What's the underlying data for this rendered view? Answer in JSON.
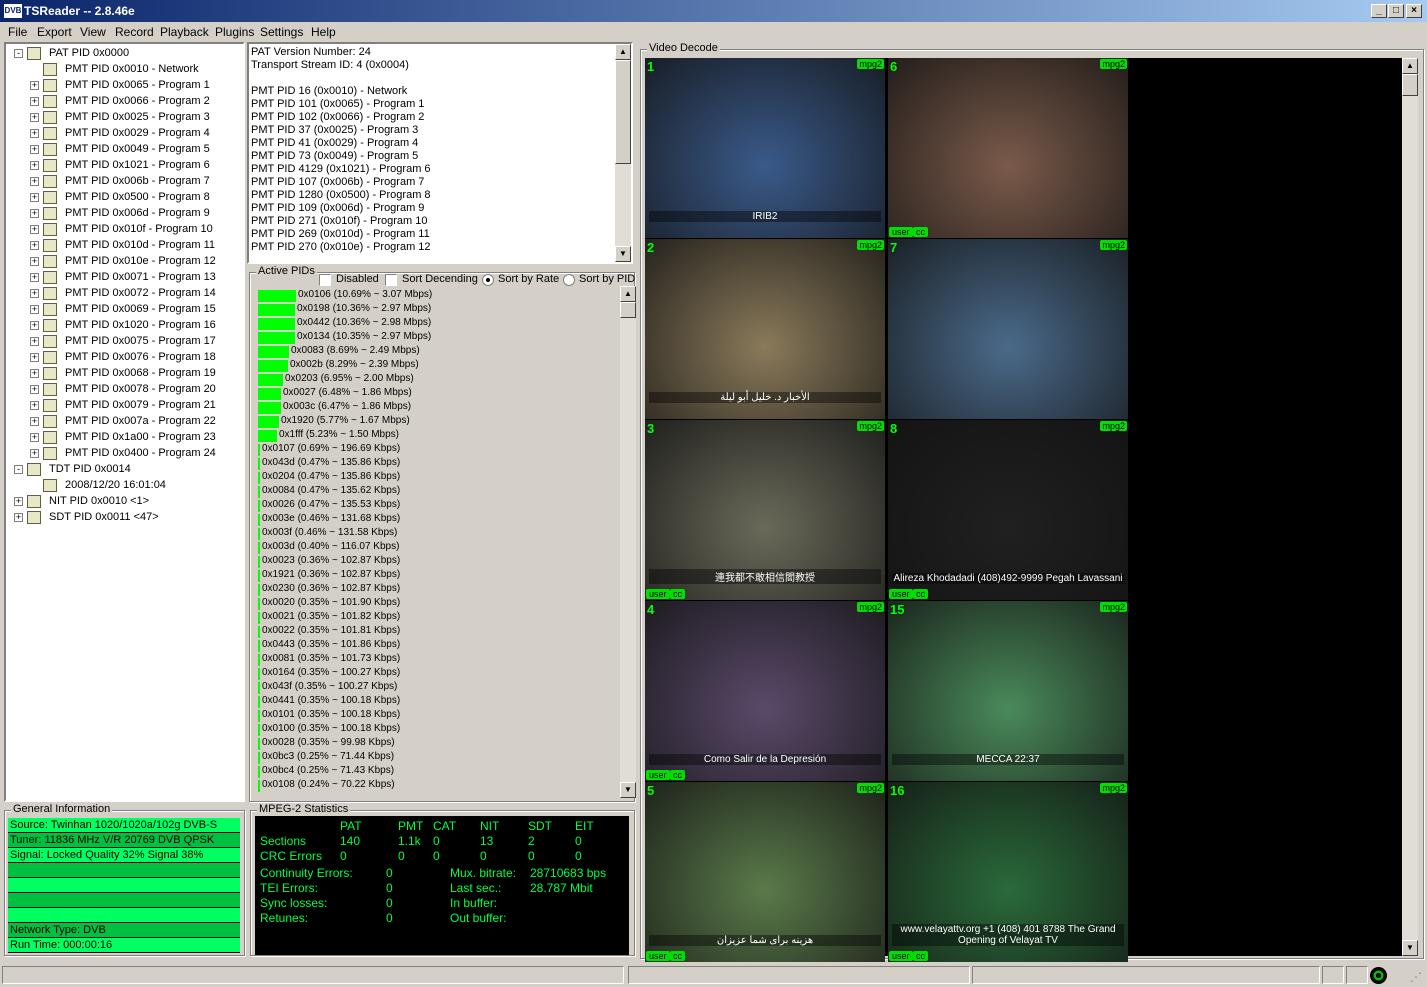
{
  "window": {
    "title": "TSReader -- 2.8.46e",
    "icon": "DVB"
  },
  "menu": [
    "File",
    "Export",
    "View",
    "Record",
    "Playback",
    "Plugins",
    "Settings",
    "Help"
  ],
  "tree": [
    {
      "label": "PAT PID 0x0000",
      "level": 0,
      "exp": "-"
    },
    {
      "label": "PMT PID 0x0010 - Network",
      "level": 1,
      "exp": ""
    },
    {
      "label": "PMT PID 0x0065 - Program 1",
      "level": 1,
      "exp": "+"
    },
    {
      "label": "PMT PID 0x0066 - Program 2",
      "level": 1,
      "exp": "+"
    },
    {
      "label": "PMT PID 0x0025 - Program 3",
      "level": 1,
      "exp": "+"
    },
    {
      "label": "PMT PID 0x0029 - Program 4",
      "level": 1,
      "exp": "+"
    },
    {
      "label": "PMT PID 0x0049 - Program 5",
      "level": 1,
      "exp": "+"
    },
    {
      "label": "PMT PID 0x1021 - Program 6",
      "level": 1,
      "exp": "+"
    },
    {
      "label": "PMT PID 0x006b - Program 7",
      "level": 1,
      "exp": "+"
    },
    {
      "label": "PMT PID 0x0500 - Program 8",
      "level": 1,
      "exp": "+"
    },
    {
      "label": "PMT PID 0x006d - Program 9",
      "level": 1,
      "exp": "+"
    },
    {
      "label": "PMT PID 0x010f - Program 10",
      "level": 1,
      "exp": "+"
    },
    {
      "label": "PMT PID 0x010d - Program 11",
      "level": 1,
      "exp": "+"
    },
    {
      "label": "PMT PID 0x010e - Program 12",
      "level": 1,
      "exp": "+"
    },
    {
      "label": "PMT PID 0x0071 - Program 13",
      "level": 1,
      "exp": "+"
    },
    {
      "label": "PMT PID 0x0072 - Program 14",
      "level": 1,
      "exp": "+"
    },
    {
      "label": "PMT PID 0x0069 - Program 15",
      "level": 1,
      "exp": "+"
    },
    {
      "label": "PMT PID 0x1020 - Program 16",
      "level": 1,
      "exp": "+"
    },
    {
      "label": "PMT PID 0x0075 - Program 17",
      "level": 1,
      "exp": "+"
    },
    {
      "label": "PMT PID 0x0076 - Program 18",
      "level": 1,
      "exp": "+"
    },
    {
      "label": "PMT PID 0x0068 - Program 19",
      "level": 1,
      "exp": "+"
    },
    {
      "label": "PMT PID 0x0078 - Program 20",
      "level": 1,
      "exp": "+"
    },
    {
      "label": "PMT PID 0x0079 - Program 21",
      "level": 1,
      "exp": "+"
    },
    {
      "label": "PMT PID 0x007a - Program 22",
      "level": 1,
      "exp": "+"
    },
    {
      "label": "PMT PID 0x1a00 - Program 23",
      "level": 1,
      "exp": "+"
    },
    {
      "label": "PMT PID 0x0400 - Program 24",
      "level": 1,
      "exp": "+"
    },
    {
      "label": "TDT PID 0x0014",
      "level": 0,
      "exp": "-"
    },
    {
      "label": "2008/12/20 16:01:04",
      "level": 1,
      "exp": ""
    },
    {
      "label": "NIT PID 0x0010 <1>",
      "level": 0,
      "exp": "+"
    },
    {
      "label": "SDT PID 0x0011 <47>",
      "level": 0,
      "exp": "+"
    }
  ],
  "patinfo": [
    "PAT Version Number: 24",
    "Transport Stream ID: 4 (0x0004)",
    "",
    "PMT PID 16 (0x0010) - Network",
    "PMT PID 101 (0x0065) - Program 1",
    "PMT PID 102 (0x0066) - Program 2",
    "PMT PID 37 (0x0025) - Program 3",
    "PMT PID 41 (0x0029) - Program 4",
    "PMT PID 73 (0x0049) - Program 5",
    "PMT PID 4129 (0x1021) - Program 6",
    "PMT PID 107 (0x006b) - Program 7",
    "PMT PID 1280 (0x0500) - Program 8",
    "PMT PID 109 (0x006d) - Program 9",
    "PMT PID 271 (0x010f) - Program 10",
    "PMT PID 269 (0x010d) - Program 11",
    "PMT PID 270 (0x010e) - Program 12"
  ],
  "active_pids": {
    "caption": "Active PIDs",
    "disabled_label": "Disabled",
    "sort_desc_label": "Sort Decending",
    "sort_rate_label": "Sort by Rate",
    "sort_pid_label": "Sort by PID",
    "rows": [
      {
        "text": "0x0106 (10.69% ~ 3.07 Mbps)",
        "pct": 10.69
      },
      {
        "text": "0x0198 (10.36% ~ 2.97 Mbps)",
        "pct": 10.36
      },
      {
        "text": "0x0442 (10.36% ~ 2.98 Mbps)",
        "pct": 10.36
      },
      {
        "text": "0x0134 (10.35% ~ 2.97 Mbps)",
        "pct": 10.35
      },
      {
        "text": "0x0083 (8.69% ~ 2.49 Mbps)",
        "pct": 8.69
      },
      {
        "text": "0x002b (8.29% ~ 2.39 Mbps)",
        "pct": 8.29
      },
      {
        "text": "0x0203 (6.95% ~ 2.00 Mbps)",
        "pct": 6.95
      },
      {
        "text": "0x0027 (6.48% ~ 1.86 Mbps)",
        "pct": 6.48
      },
      {
        "text": "0x003c (6.47% ~ 1.86 Mbps)",
        "pct": 6.47
      },
      {
        "text": "0x1920 (5.77% ~ 1.67 Mbps)",
        "pct": 5.77
      },
      {
        "text": "0x1fff (5.23% ~ 1.50 Mbps)",
        "pct": 5.23
      },
      {
        "text": "0x0107 (0.69% ~ 196.69 Kbps)",
        "pct": 0.69
      },
      {
        "text": "0x043d (0.47% ~ 135.86 Kbps)",
        "pct": 0.47
      },
      {
        "text": "0x0204 (0.47% ~ 135.86 Kbps)",
        "pct": 0.47
      },
      {
        "text": "0x0084 (0.47% ~ 135.62 Kbps)",
        "pct": 0.47
      },
      {
        "text": "0x0026 (0.47% ~ 135.53 Kbps)",
        "pct": 0.47
      },
      {
        "text": "0x003e (0.46% ~ 131.68 Kbps)",
        "pct": 0.46
      },
      {
        "text": "0x003f (0.46% ~ 131.58 Kbps)",
        "pct": 0.46
      },
      {
        "text": "0x003d (0.40% ~ 116.07 Kbps)",
        "pct": 0.4
      },
      {
        "text": "0x0023 (0.36% ~ 102.87 Kbps)",
        "pct": 0.36
      },
      {
        "text": "0x1921 (0.36% ~ 102.87 Kbps)",
        "pct": 0.36
      },
      {
        "text": "0x0230 (0.36% ~ 102.87 Kbps)",
        "pct": 0.36
      },
      {
        "text": "0x0020 (0.35% ~ 101.90 Kbps)",
        "pct": 0.35
      },
      {
        "text": "0x0021 (0.35% ~ 101.82 Kbps)",
        "pct": 0.35
      },
      {
        "text": "0x0022 (0.35% ~ 101.81 Kbps)",
        "pct": 0.35
      },
      {
        "text": "0x0443 (0.35% ~ 101.86 Kbps)",
        "pct": 0.35
      },
      {
        "text": "0x0081 (0.35% ~ 101.73 Kbps)",
        "pct": 0.35
      },
      {
        "text": "0x0164 (0.35% ~ 100.27 Kbps)",
        "pct": 0.35
      },
      {
        "text": "0x043f (0.35% ~ 100.27 Kbps)",
        "pct": 0.35
      },
      {
        "text": "0x0441 (0.35% ~ 100.18 Kbps)",
        "pct": 0.35
      },
      {
        "text": "0x0101 (0.35% ~ 100.18 Kbps)",
        "pct": 0.35
      },
      {
        "text": "0x0100 (0.35% ~ 100.18 Kbps)",
        "pct": 0.35
      },
      {
        "text": "0x0028 (0.35% ~ 99.98 Kbps)",
        "pct": 0.35
      },
      {
        "text": "0x0bc3 (0.25% ~ 71.44 Kbps)",
        "pct": 0.25
      },
      {
        "text": "0x0bc4 (0.25% ~ 71.43 Kbps)",
        "pct": 0.25
      },
      {
        "text": "0x0108 (0.24% ~ 70.22 Kbps)",
        "pct": 0.24
      }
    ]
  },
  "general": {
    "caption": "General Information",
    "lines": [
      "Source: Twinhan 1020/1020a/102g DVB-S",
      "Tuner: 11836 MHz V/R 20769 DVB QPSK",
      "Signal: Locked Quality 32% Signal 38%",
      "",
      "",
      "",
      "",
      "Network Type: DVB",
      "Run Time: 000:00:16"
    ]
  },
  "mpeg": {
    "caption": "MPEG-2 Statistics",
    "headers": [
      "PAT",
      "PMT",
      "CAT",
      "NIT",
      "SDT",
      "EIT"
    ],
    "sections_label": "Sections",
    "sections": [
      "140",
      "1.1k",
      "0",
      "13",
      "2",
      "0"
    ],
    "crc_label": "CRC Errors",
    "crc": [
      "0",
      "0",
      "0",
      "0",
      "0",
      "0"
    ],
    "left": [
      {
        "l": "Continuity Errors:",
        "v": "0"
      },
      {
        "l": "TEI Errors:",
        "v": "0"
      },
      {
        "l": "Sync losses:",
        "v": "0"
      },
      {
        "l": "Retunes:",
        "v": "0"
      }
    ],
    "right": [
      {
        "l": "Mux. bitrate:",
        "v": "28710683 bps"
      },
      {
        "l": "Last sec.:",
        "v": "28.787 Mbit"
      },
      {
        "l": "In buffer:",
        "v": ""
      },
      {
        "l": "Out buffer:",
        "v": ""
      }
    ]
  },
  "video": {
    "caption": "Video Decode",
    "tiles": [
      {
        "num": "1",
        "codec": "mpg2",
        "badges": [],
        "desc": "studio set",
        "color": "#3a5a8a",
        "tag": "IRIB2"
      },
      {
        "num": "6",
        "codec": "mpg2",
        "badges": [
          "user",
          "cc"
        ],
        "desc": "talk show",
        "color": "#7a5a4a",
        "tag": ""
      },
      {
        "num": "2",
        "codec": "mpg2",
        "badges": [],
        "desc": "news",
        "color": "#8a7a5a",
        "tag": "الأخبار د. خليل أبو ليلة"
      },
      {
        "num": "7",
        "codec": "mpg2",
        "badges": [],
        "desc": "map",
        "color": "#4a6a8a",
        "tag": ""
      },
      {
        "num": "3",
        "codec": "mpg2",
        "badges": [
          "user",
          "cc"
        ],
        "desc": "drama",
        "color": "#6a6a5a",
        "tag": "連我都不敢相信閻教授"
      },
      {
        "num": "8",
        "codec": "mpg2",
        "badges": [
          "user",
          "cc"
        ],
        "desc": "hosts",
        "color": "#202020",
        "tag": "Alireza Khodadadi (408)492-9999 Pegah Lavassani"
      },
      {
        "num": "4",
        "codec": "mpg2",
        "badges": [
          "user",
          "cc"
        ],
        "desc": "church",
        "color": "#5a4a6a",
        "tag": "Como Salir de la Depresión"
      },
      {
        "num": "15",
        "codec": "mpg2",
        "badges": [],
        "desc": "anchor",
        "color": "#4a8a5a",
        "tag": "MECCA 22:37"
      },
      {
        "num": "5",
        "codec": "mpg2",
        "badges": [
          "user",
          "cc"
        ],
        "desc": "art",
        "color": "#5a7a4a",
        "tag": "هزینه برای شما عزیزان"
      },
      {
        "num": "16",
        "codec": "mpg2",
        "badges": [
          "user",
          "cc"
        ],
        "desc": "velayat",
        "color": "#2a6a3a",
        "tag": "www.velayattv.org +1 (408) 401 8788 The Grand Opening of Velayat TV"
      }
    ]
  }
}
